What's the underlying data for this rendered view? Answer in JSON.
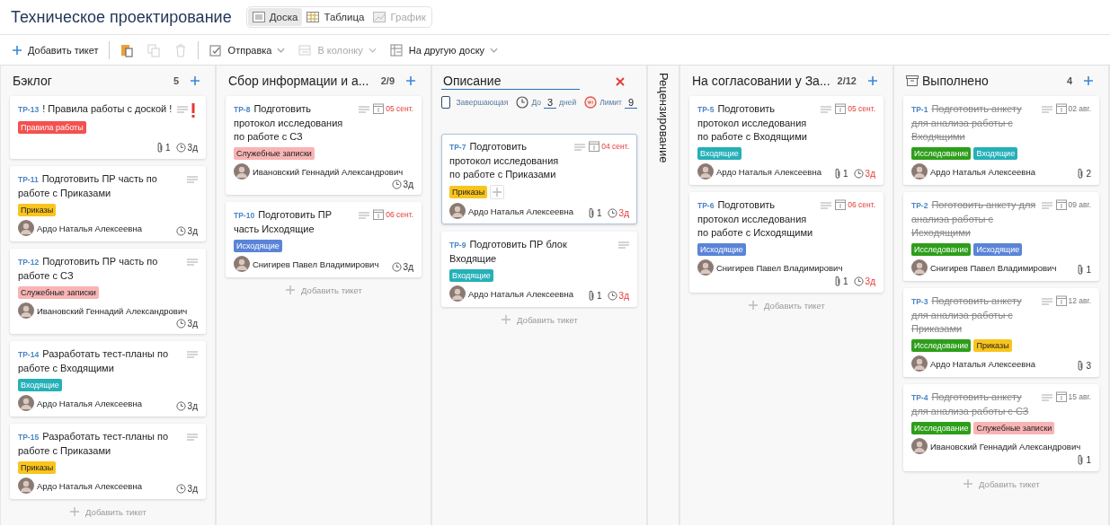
{
  "header": {
    "title": "Техническое проектирование",
    "views": [
      {
        "label": "Доска",
        "kind": "board",
        "selected": true,
        "disabled": false
      },
      {
        "label": "Таблица",
        "kind": "table",
        "selected": false,
        "disabled": false
      },
      {
        "label": "График",
        "kind": "chart",
        "selected": false,
        "disabled": true
      }
    ]
  },
  "toolbar": [
    {
      "kind": "add",
      "label": "Добавить тикет",
      "disabled": false
    },
    {
      "kind": "paste",
      "disabled": false
    },
    {
      "kind": "copy",
      "disabled": true
    },
    {
      "kind": "delete",
      "disabled": true
    },
    {
      "kind": "send",
      "label": "Отправка",
      "disabled": false
    },
    {
      "kind": "column",
      "label": "В колонку",
      "disabled": true
    },
    {
      "kind": "board",
      "label": "На другую доску",
      "disabled": false
    }
  ],
  "columns": [
    {
      "kind": "list",
      "title": "Бэклог",
      "count": "5",
      "add_label": "Добавить тикет",
      "cards": [
        {
          "id": "ТР-13",
          "title": "! Правила работы с доской !",
          "urgent": true,
          "done": false,
          "selected": false,
          "tags": [
            {
              "text": "Правила работы",
              "color": "#f2514f"
            }
          ],
          "attachments": "1",
          "age": {
            "text": "3д",
            "overdue": false
          }
        },
        {
          "id": "ТР-11",
          "title": "Подготовить ПР часть по работе с Приказами",
          "urgent": false,
          "done": false,
          "selected": false,
          "tags": [
            {
              "text": "Приказы",
              "color": "#f9c51d"
            }
          ],
          "assignee": "Ардо Наталья Алексеевна",
          "age": {
            "text": "3д",
            "overdue": false
          }
        },
        {
          "id": "ТР-12",
          "title": "Подготовить ПР часть по работе с СЗ",
          "urgent": false,
          "done": false,
          "selected": false,
          "tags": [
            {
              "text": "Служебные записки",
              "color": "#f8b4b4"
            }
          ],
          "assignee": "Ивановский Геннадий Александрович",
          "age": {
            "text": "3д",
            "overdue": false
          }
        },
        {
          "id": "ТР-14",
          "title": "Разработать тест-планы по работе с Входящими",
          "urgent": false,
          "done": false,
          "selected": false,
          "tags": [
            {
              "text": "Входящие",
              "color": "#25b0b8"
            }
          ],
          "assignee": "Ардо Наталья Алексеевна",
          "age": {
            "text": "3д",
            "overdue": false
          }
        },
        {
          "id": "ТР-15",
          "title": "Разработать тест-планы по работе с Приказами",
          "urgent": false,
          "done": false,
          "selected": false,
          "tags": [
            {
              "text": "Приказы",
              "color": "#f9c51d"
            }
          ],
          "assignee": "Ардо Наталья Алексеевна",
          "age": {
            "text": "3д",
            "overdue": false
          }
        }
      ]
    },
    {
      "kind": "list",
      "title": "Сбор информации и а...",
      "count": "2/9",
      "add_label": "Добавить тикет",
      "cards": [
        {
          "id": "ТР-8",
          "title": "Подготовить протокол исследования по работе с СЗ",
          "urgent": false,
          "done": false,
          "selected": false,
          "due": {
            "text": "05 сент.",
            "overdue": true
          },
          "tags": [
            {
              "text": "Служебные записки",
              "color": "#f8b4b4"
            }
          ],
          "assignee": "Ивановский Геннадий Александрович",
          "age": {
            "text": "3д",
            "overdue": false
          }
        },
        {
          "id": "ТР-10",
          "title": "Подготовить ПР часть Исходящие",
          "urgent": false,
          "done": false,
          "selected": false,
          "due": {
            "text": "06 сент.",
            "overdue": true
          },
          "tags": [
            {
              "text": "Исходящие",
              "color": "#5a84d8"
            }
          ],
          "assignee": "Снигирев Павел Владимирович",
          "age": {
            "text": "3д",
            "overdue": false
          }
        }
      ]
    },
    {
      "kind": "editing",
      "title": "Описание",
      "final_label": "Завершающая",
      "final": false,
      "due_prefix": "До",
      "due_days": "3",
      "due_suffix": "дней",
      "limit_label": "Лимит",
      "limit": "9",
      "add_label": "Добавить тикет",
      "cards": [
        {
          "id": "ТР-7",
          "title": "Подготовить протокол исследования по работе с Приказами",
          "urgent": false,
          "done": false,
          "selected": true,
          "due": {
            "text": "04 сент.",
            "overdue": true
          },
          "tags": [
            {
              "text": "Приказы",
              "color": "#f9c51d"
            }
          ],
          "assignee": "Ардо Наталья Алексеевна",
          "attachments": "1",
          "age": {
            "text": "3д",
            "overdue": true
          }
        },
        {
          "id": "ТР-9",
          "title": "Подготовить ПР блок Входящие",
          "urgent": false,
          "done": false,
          "selected": false,
          "tags": [
            {
              "text": "Входящие",
              "color": "#25b0b8"
            }
          ],
          "assignee": "Ардо Наталья Алексеевна",
          "attachments": "1",
          "age": {
            "text": "3д",
            "overdue": true
          }
        }
      ]
    },
    {
      "kind": "collapsed",
      "title": "Рецензирование"
    },
    {
      "kind": "list",
      "title": "На согласовании у За...",
      "count": "2/12",
      "add_label": "Добавить тикет",
      "cards": [
        {
          "id": "ТР-5",
          "title": "Подготовить протокол исследования по работе с Входящими",
          "urgent": false,
          "done": false,
          "selected": false,
          "due": {
            "text": "05 сент.",
            "overdue": true
          },
          "tags": [
            {
              "text": "Входящие",
              "color": "#25b0b8"
            }
          ],
          "assignee": "Ардо Наталья Алексеевна",
          "attachments": "1",
          "age": {
            "text": "3д",
            "overdue": true
          }
        },
        {
          "id": "ТР-6",
          "title": "Подготовить протокол исследования по работе с Исходящими",
          "urgent": false,
          "done": false,
          "selected": false,
          "due": {
            "text": "06 сент.",
            "overdue": true
          },
          "tags": [
            {
              "text": "Исходящие",
              "color": "#5a84d8"
            }
          ],
          "assignee": "Снигирев Павел Владимирович",
          "attachments": "1",
          "age": {
            "text": "3д",
            "overdue": true
          }
        }
      ]
    },
    {
      "kind": "archive",
      "title": "Выполнено",
      "count": "4",
      "add_label": "Добавить тикет",
      "cards": [
        {
          "id": "ТР-1",
          "title": "Подготовить анкету для анализа работы с Входящими",
          "urgent": false,
          "done": true,
          "selected": false,
          "due": {
            "text": "02 авг.",
            "overdue": false
          },
          "tags": [
            {
              "text": "Исследование",
              "color": "#2e9e1a"
            },
            {
              "text": "Входящие",
              "color": "#25b0b8"
            }
          ],
          "assignee": "Ардо Наталья Алексеевна",
          "attachments": "2"
        },
        {
          "id": "ТР-2",
          "title": "Поготовить анкету для анализа работы с Исходящими",
          "urgent": false,
          "done": true,
          "selected": false,
          "due": {
            "text": "09 авг.",
            "overdue": false
          },
          "tags": [
            {
              "text": "Исследование",
              "color": "#2e9e1a"
            },
            {
              "text": "Исходящие",
              "color": "#5a84d8"
            }
          ],
          "assignee": "Снигирев Павел Владимирович",
          "attachments": "1"
        },
        {
          "id": "ТР-3",
          "title": "Подготовить анкету для анализа работы с Приказами",
          "urgent": false,
          "done": true,
          "selected": false,
          "due": {
            "text": "12 авг.",
            "overdue": false
          },
          "tags": [
            {
              "text": "Исследование",
              "color": "#2e9e1a"
            },
            {
              "text": "Приказы",
              "color": "#f9c51d"
            }
          ],
          "assignee": "Ардо Наталья Алексеевна",
          "attachments": "3"
        },
        {
          "id": "ТР-4",
          "title": "Подготовить анкету для анализа работы с СЗ",
          "urgent": false,
          "done": true,
          "selected": false,
          "due": {
            "text": "15 авг.",
            "overdue": false
          },
          "tags": [
            {
              "text": "Исследование",
              "color": "#2e9e1a"
            },
            {
              "text": "Служебные записки",
              "color": "#f8b4b4"
            }
          ],
          "assignee": "Ивановский Геннадий Александрович",
          "attachments": "1"
        }
      ]
    }
  ]
}
